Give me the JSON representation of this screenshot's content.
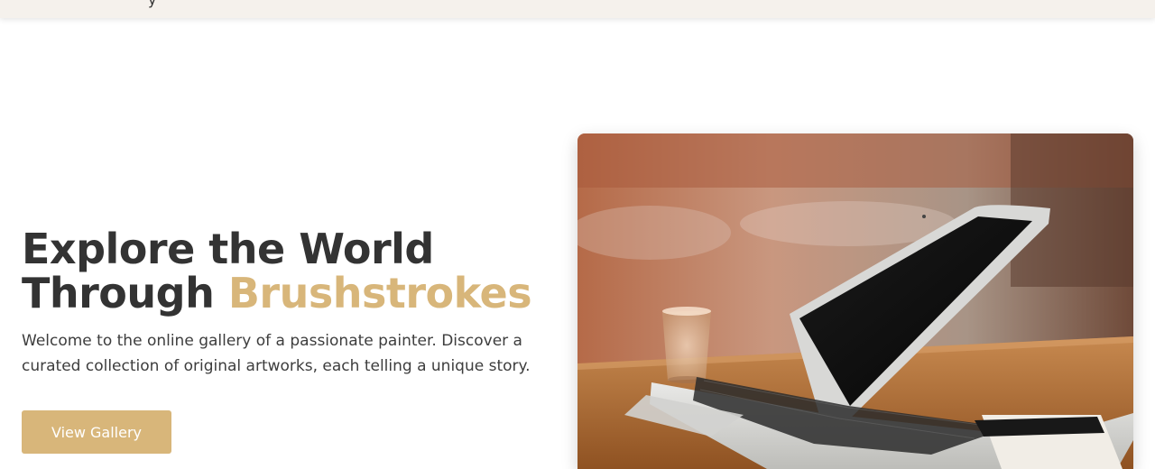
{
  "header": {
    "partial_glyph": "y"
  },
  "hero": {
    "title_line1": "Explore the World",
    "title_line2_plain": "Through",
    "title_line2_accent": "Brushstrokes",
    "subtitle": "Welcome to the online gallery of a passionate painter. Discover a curated collection of original artworks, each telling a unique story.",
    "cta_label": "View Gallery",
    "image_label": "MacBook Air",
    "image_description": "laptop-on-wooden-table"
  },
  "colors": {
    "accent": "#d8b67a",
    "heading": "#333333",
    "header_bg": "#f5f1ec"
  }
}
